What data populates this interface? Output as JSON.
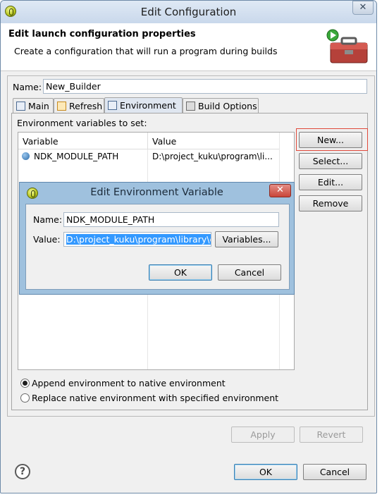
{
  "window": {
    "title": "Edit Configuration"
  },
  "header": {
    "title": "Edit launch configuration properties",
    "message": "Create a configuration that will run a program during builds"
  },
  "name_field": {
    "label": "Name:",
    "value": "New_Builder"
  },
  "tabs": [
    {
      "label": "Main"
    },
    {
      "label": "Refresh"
    },
    {
      "label": "Environment"
    },
    {
      "label": "Build Options"
    }
  ],
  "environment": {
    "caption": "Environment variables to set:",
    "columns": [
      "Variable",
      "Value"
    ],
    "rows": [
      {
        "variable": "NDK_MODULE_PATH",
        "value": "D:\\project_kuku\\program\\li..."
      }
    ],
    "buttons": {
      "new": "New...",
      "select": "Select...",
      "edit": "Edit...",
      "remove": "Remove"
    },
    "radio_append": "Append environment to native environment",
    "radio_replace": "Replace native environment with specified environment"
  },
  "edit_dialog": {
    "title": "Edit Environment Variable",
    "close_glyph": "✕",
    "name_label": "Name:",
    "name_value": "NDK_MODULE_PATH",
    "value_label": "Value:",
    "value_value": "D:\\project_kuku\\program\\library\\c",
    "variables_button": "Variables...",
    "ok_button": "OK",
    "cancel_button": "Cancel"
  },
  "footer": {
    "apply": "Apply",
    "revert": "Revert",
    "ok": "OK",
    "cancel": "Cancel",
    "help_glyph": "?"
  },
  "colors": {
    "accent": "#3399ff",
    "highlight": "#e04a3b",
    "dialog_frame": "#9fc1de"
  }
}
